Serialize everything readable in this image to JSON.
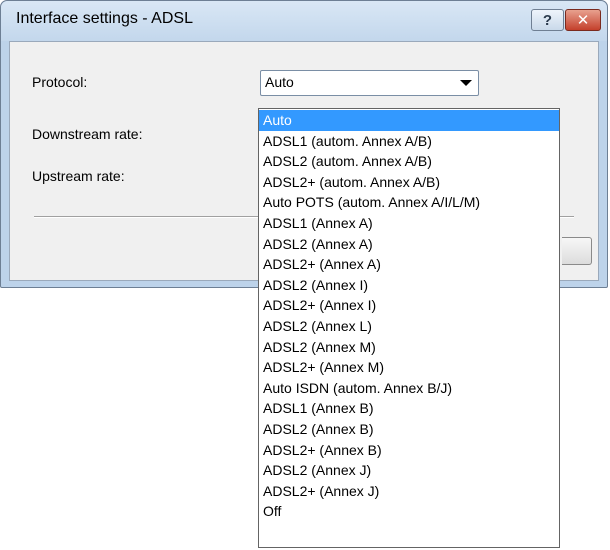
{
  "window": {
    "title": "Interface settings - ADSL",
    "help_glyph": "?",
    "close_glyph": "✕"
  },
  "form": {
    "protocol_label": "Protocol:",
    "downstream_label": "Downstream rate:",
    "upstream_label": "Upstream rate:",
    "protocol_value": "Auto"
  },
  "dropdown": {
    "selected_index": 0,
    "options": [
      "Auto",
      "ADSL1 (autom. Annex A/B)",
      "ADSL2 (autom. Annex A/B)",
      "ADSL2+ (autom. Annex A/B)",
      "Auto POTS (autom. Annex A/I/L/M)",
      "ADSL1 (Annex A)",
      "ADSL2 (Annex A)",
      "ADSL2+ (Annex A)",
      "ADSL2 (Annex I)",
      "ADSL2+ (Annex I)",
      "ADSL2 (Annex L)",
      "ADSL2 (Annex M)",
      "ADSL2+ (Annex M)",
      "Auto ISDN (autom. Annex B/J)",
      "ADSL1 (Annex B)",
      "ADSL2 (Annex B)",
      "ADSL2+ (Annex B)",
      "ADSL2 (Annex J)",
      "ADSL2+ (Annex J)",
      "Off"
    ]
  },
  "colors": {
    "selection": "#3399ff",
    "titlebar": "#c3d7ec",
    "close_button": "#c4402c"
  }
}
